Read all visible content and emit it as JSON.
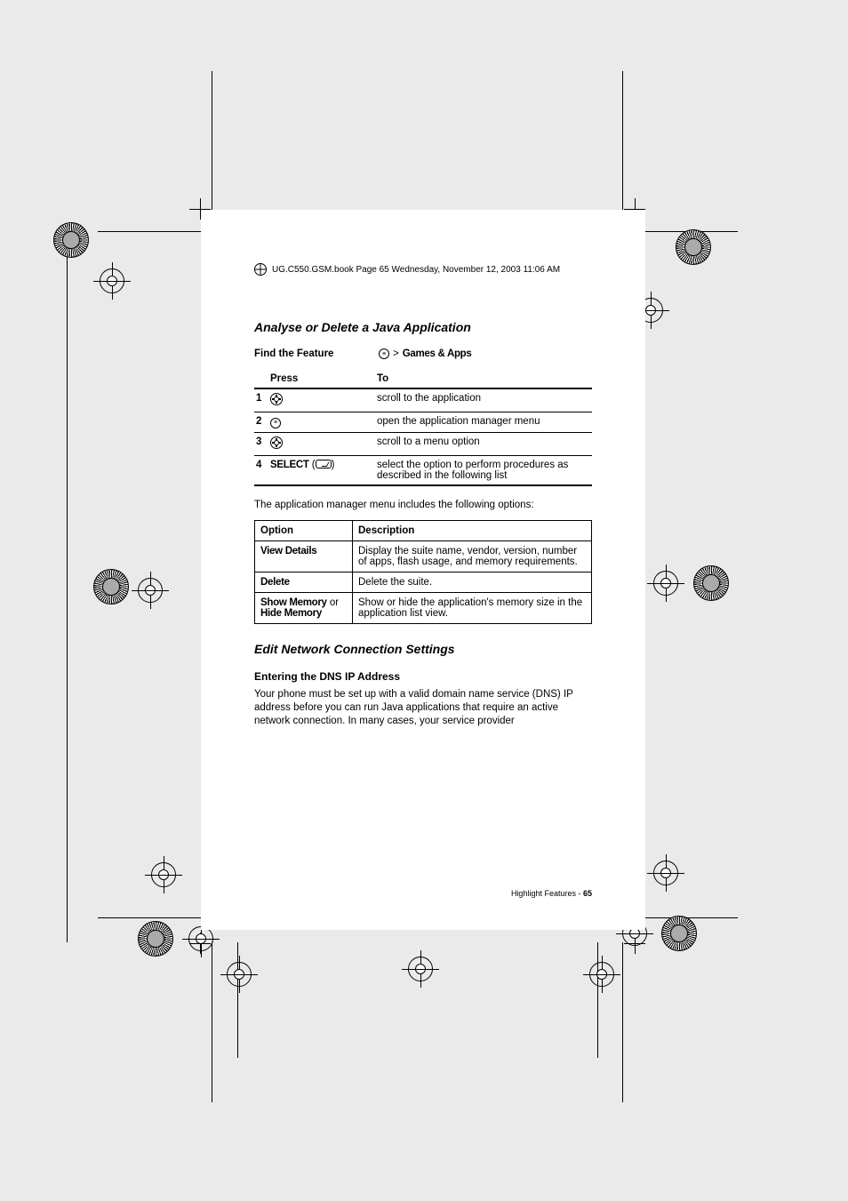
{
  "header_line": "UG.C550.GSM.book  Page 65  Wednesday, November 12, 2003  11:06 AM",
  "section1_title": "Analyse or Delete a Java Application",
  "find_feature_label": "Find the Feature",
  "menu_path": "Games & Apps",
  "gt": ">",
  "steps_head_press": "Press",
  "steps_head_to": "To",
  "steps": [
    {
      "num": "1",
      "press_icon": "nav",
      "press_text": "",
      "to": "scroll to the application"
    },
    {
      "num": "2",
      "press_icon": "menu",
      "press_text": "",
      "to": "open the application manager menu"
    },
    {
      "num": "3",
      "press_icon": "nav",
      "press_text": "",
      "to": "scroll to a menu option"
    },
    {
      "num": "4",
      "press_icon": "soft",
      "press_text": "SELECT",
      "to": "select the option to perform procedures as described in the following list"
    }
  ],
  "intro_para": "The application manager menu includes the following options:",
  "options_head_option": "Option",
  "options_head_desc": "Description",
  "options": [
    {
      "opt": "View Details",
      "desc": "Display the suite name, vendor, version, number of apps, flash usage, and memory requirements."
    },
    {
      "opt": "Delete",
      "desc": "Delete the suite."
    },
    {
      "opt": "Show Memory or Hide Memory",
      "opt_plain_or": " or ",
      "opt_a": "Show Memory",
      "opt_b": "Hide Memory",
      "desc": "Show or hide the application's memory size in the application list view."
    }
  ],
  "section2_title": "Edit Network Connection Settings",
  "dns_heading": "Entering the DNS IP Address",
  "dns_para": "Your phone must be set up with a valid domain name service (DNS) IP address before you can run Java applications that require an active network connection. In many cases, your service provider",
  "footer_section": "Highlight Features - ",
  "footer_page": "65",
  "open_paren": "(",
  "close_paren": ")"
}
